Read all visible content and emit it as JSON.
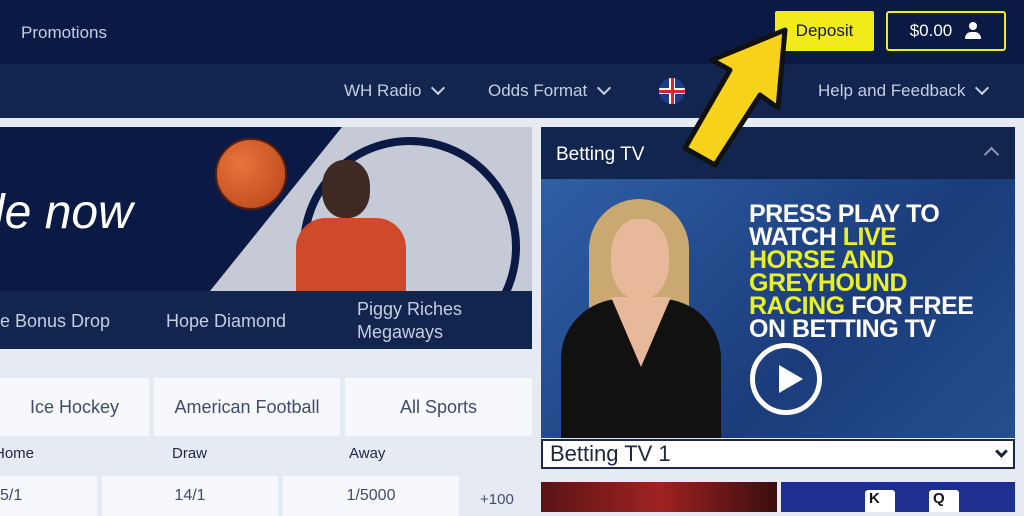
{
  "topbar": {
    "promotions": "Promotions",
    "deposit": "Deposit",
    "balance": "$0.00",
    "user_icon": "user-icon"
  },
  "nav": {
    "items": [
      "WH Radio",
      "Odds Format",
      "Help and Feedback"
    ],
    "hidden_item_suffix": "|"
  },
  "banner": {
    "title": "le now"
  },
  "games": [
    "e Bonus Drop",
    "Hope Diamond",
    "Piggy Riches",
    "Megaways"
  ],
  "sports": [
    "Ice Hockey",
    "American Football",
    "All Sports"
  ],
  "odds": {
    "headers": [
      "Home",
      "Draw",
      "Away"
    ],
    "values": [
      "5/1",
      "14/1",
      "1/5000"
    ],
    "more": "+100"
  },
  "tv": {
    "title": "Betting TV",
    "promo_lines": [
      "PRESS PLAY TO",
      "WATCH",
      "LIVE",
      "HORSE AND",
      "GREYHOUND",
      "RACING",
      "FOR FREE",
      "ON BETTING TV"
    ],
    "channel": "Betting TV 1"
  },
  "cards": [
    "K",
    "Q"
  ],
  "colors": {
    "brand_navy": "#0b1a45",
    "deposit_yellow": "#f3ea1c",
    "highlight": "#e8f028"
  }
}
